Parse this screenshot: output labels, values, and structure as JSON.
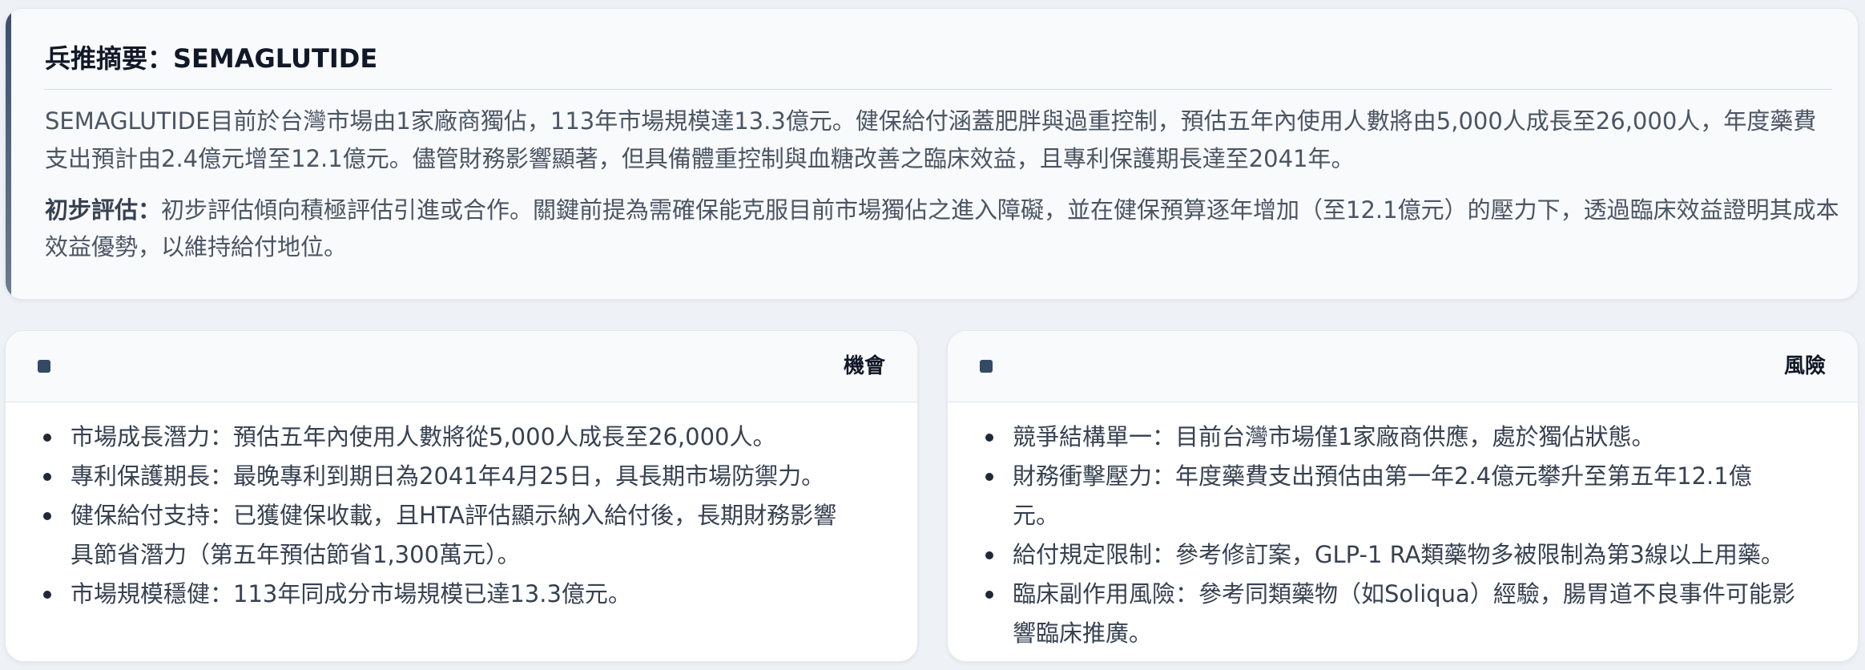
{
  "summary": {
    "title": "兵推摘要：SEMAGLUTIDE",
    "paragraph": "SEMAGLUTIDE目前於台灣市場由1家廠商獨佔，113年市場規模達13.3億元。健保給付涵蓋肥胖與過重控制，預估五年內使用人數將由5,000人成長至26,000人，年度藥費支出預計由2.4億元增至12.1億元。儘管財務影響顯著，但具備體重控制與血糖改善之臨床效益，且專利保護期長達至2041年。",
    "assessment_label": "初步評估：",
    "assessment_text": "初步評估傾向積極評估引進或合作。關鍵前提為需確保能克服目前市場獨佔之進入障礙，並在健保預算逐年增加（至12.1億元）的壓力下，透過臨床效益證明其成本效益優勢，以維持給付地位。"
  },
  "opportunities": {
    "title": "機會",
    "items": [
      "市場成長潛力：預估五年內使用人數將從5,000人成長至26,000人。",
      "專利保護期長：最晚專利到期日為2041年4月25日，具長期市場防禦力。",
      "健保給付支持：已獲健保收載，且HTA評估顯示納入給付後，長期財務影響具節省潛力（第五年預估節省1,300萬元）。",
      "市場規模穩健：113年同成分市場規模已達13.3億元。"
    ]
  },
  "risks": {
    "title": "風險",
    "items": [
      "競爭結構單一：目前台灣市場僅1家廠商供應，處於獨佔狀態。",
      "財務衝擊壓力：年度藥費支出預估由第一年2.4億元攀升至第五年12.1億元。",
      "給付規定限制：參考修訂案，GLP-1 RA類藥物多被限制為第3線以上用藥。",
      "臨床副作用風險：參考同類藥物（如Soliqua）經驗，腸胃道不良事件可能影響臨床推廣。"
    ]
  },
  "colors": {
    "accent": "#334a66",
    "background": "#eef2f6",
    "card": "#ffffff"
  }
}
